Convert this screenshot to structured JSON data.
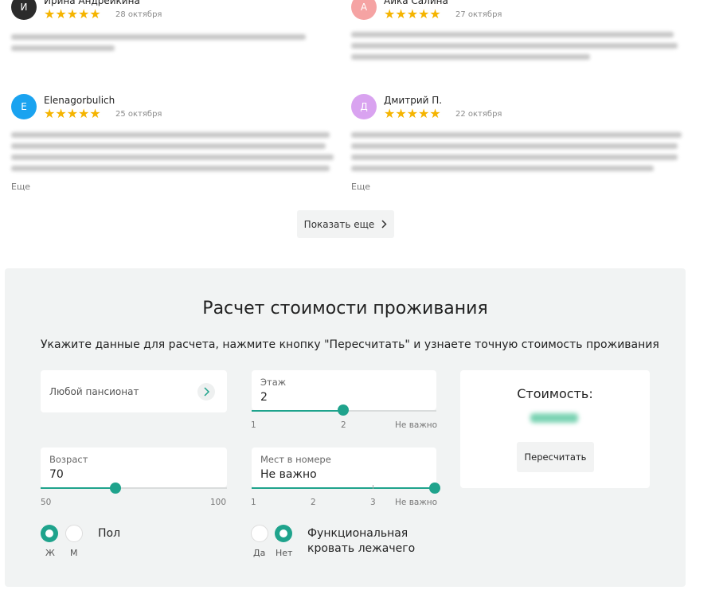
{
  "reviews": [
    {
      "initial": "И",
      "name": "Ирина Андрейкина",
      "stars": "★★★★★",
      "rating": 5,
      "date": "28 октября",
      "color": "#2b2b2b"
    },
    {
      "initial": "А",
      "name": "Аика Салина",
      "stars": "★★★★★",
      "rating": 5,
      "date": "27 октября",
      "color": "#f5a3a3"
    },
    {
      "initial": "E",
      "name": "Elenagorbulich",
      "stars": "★★★★★",
      "rating": 5,
      "date": "25 октября",
      "color": "#1aa3f0",
      "more": "Еще"
    },
    {
      "initial": "Д",
      "name": "Дмитрий П.",
      "stars": "★★★★★",
      "rating": 5,
      "date": "22 октября",
      "color": "#d9a3f0",
      "more": "Еще"
    }
  ],
  "show_more": {
    "label": "Показать еще",
    "icon": "chevron-right-icon"
  },
  "calc": {
    "title": "Расчет стоимости проживания",
    "description": "Укажите данные для расчета, нажмите кнопку \"Пересчитать\" и узнаете точную стоимость проживания",
    "pansionat": {
      "value": "Любой пансионат",
      "icon": "chevron-right-icon"
    },
    "floor": {
      "label": "Этаж",
      "value": "2",
      "ticks": [
        "1",
        "2",
        "Не важно"
      ],
      "position": 0.5
    },
    "age": {
      "label": "Возраст",
      "value": "70",
      "min": "50",
      "max": "100",
      "position": 0.4
    },
    "beds": {
      "label": "Мест в номере",
      "value": "Не важно",
      "ticks": [
        "1",
        "2",
        "3",
        "Не важно"
      ],
      "position": 1.0
    },
    "sex": {
      "label": "Пол",
      "options": [
        "Ж",
        "М"
      ],
      "selected": "Ж"
    },
    "bed": {
      "label_line1": "Функциональная",
      "label_line2": "кровать лежачего",
      "options": [
        "Да",
        "Нет"
      ],
      "selected": "Нет"
    },
    "price": {
      "title": "Стоимость:",
      "recalc_label": "Пересчитать"
    },
    "accent_color": "#1fa38c"
  }
}
